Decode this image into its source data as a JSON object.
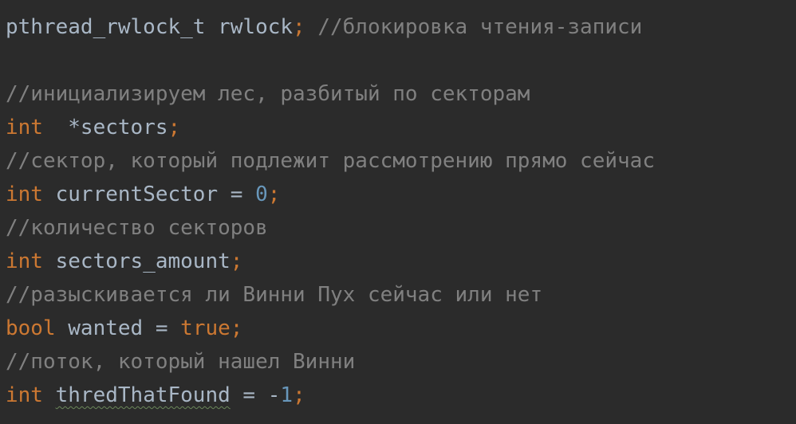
{
  "code_lines": [
    {
      "tokens": [
        {
          "text": "pthread_rwlock_t rwlock",
          "type": "id"
        },
        {
          "text": ";",
          "type": "kw"
        },
        {
          "text": " //блокировка чтения-записи",
          "type": "cm"
        }
      ]
    },
    {
      "tokens": []
    },
    {
      "tokens": [
        {
          "text": "//инициализируем лес, разбитый по секторам",
          "type": "cm"
        }
      ]
    },
    {
      "tokens": [
        {
          "text": "int",
          "type": "kw"
        },
        {
          "text": "  *sectors",
          "type": "id"
        },
        {
          "text": ";",
          "type": "kw"
        }
      ]
    },
    {
      "tokens": [
        {
          "text": "//сектор, который подлежит рассмотрению прямо сейчас",
          "type": "cm"
        }
      ]
    },
    {
      "tokens": [
        {
          "text": "int",
          "type": "kw"
        },
        {
          "text": " currentSector = ",
          "type": "id"
        },
        {
          "text": "0",
          "type": "num"
        },
        {
          "text": ";",
          "type": "kw"
        }
      ]
    },
    {
      "tokens": [
        {
          "text": "//количество секторов",
          "type": "cm"
        }
      ]
    },
    {
      "tokens": [
        {
          "text": "int",
          "type": "kw"
        },
        {
          "text": " sectors_amount",
          "type": "id"
        },
        {
          "text": ";",
          "type": "kw"
        }
      ]
    },
    {
      "tokens": [
        {
          "text": "//разыскивается ли Винни Пух сейчас или нет",
          "type": "cm"
        }
      ]
    },
    {
      "tokens": [
        {
          "text": "bool",
          "type": "kw"
        },
        {
          "text": " wanted = ",
          "type": "id"
        },
        {
          "text": "true",
          "type": "kw"
        },
        {
          "text": ";",
          "type": "kw"
        }
      ]
    },
    {
      "tokens": [
        {
          "text": "//поток, который нашел Винни",
          "type": "cm"
        }
      ]
    },
    {
      "tokens": [
        {
          "text": "int",
          "type": "kw"
        },
        {
          "text": " ",
          "type": "id"
        },
        {
          "text": "thredThatFound",
          "type": "id",
          "squiggle": true
        },
        {
          "text": " = -",
          "type": "id"
        },
        {
          "text": "1",
          "type": "num"
        },
        {
          "text": ";",
          "type": "kw"
        }
      ]
    }
  ],
  "colors": {
    "background": "#2b2b2b",
    "keyword": "#cc7832",
    "comment": "#808080",
    "number": "#6897bb",
    "identifier": "#a9b7c6",
    "typo_underline": "#6a8759"
  }
}
